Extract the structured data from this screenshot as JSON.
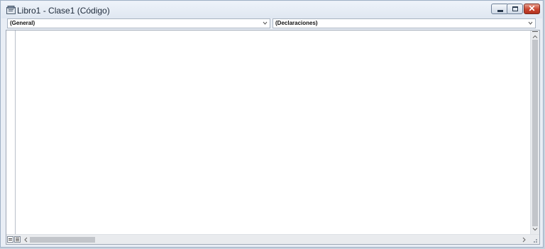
{
  "window": {
    "title": "Libro1 - Clase1 (Código)",
    "icon": "vba-module-icon",
    "controls": {
      "minimize": "minimize-icon",
      "maximize": "maximize-icon",
      "close": "close-icon",
      "close_glyph": "✕"
    }
  },
  "toolbar": {
    "object_combo": {
      "value": "(General)"
    },
    "procedure_combo": {
      "value": "(Declaraciones)"
    }
  },
  "editor": {
    "code": ""
  },
  "colors": {
    "titlebar": "#e4ebf4",
    "close_button": "#c9452f",
    "editor_background": "#ffffff"
  }
}
